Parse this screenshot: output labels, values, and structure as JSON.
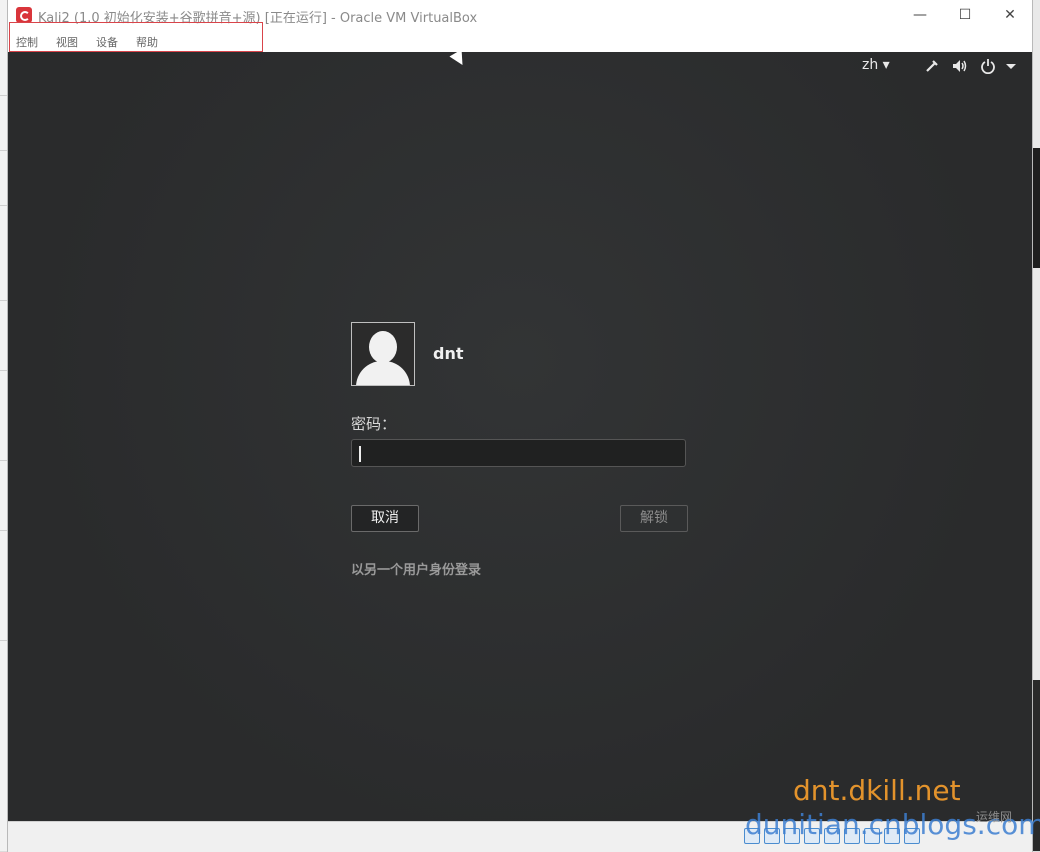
{
  "window": {
    "title": "Kali2 (1.0 初始化安装+谷歌拼音+源) [正在运行] - Oracle VM VirtualBox",
    "controls": {
      "minimize": "—",
      "maximize": "☐",
      "close": "✕"
    }
  },
  "menubar": {
    "items": [
      "控制",
      "视图",
      "设备",
      "帮助"
    ]
  },
  "guest_panel": {
    "language": "zh ▾",
    "icons": [
      "network-icon",
      "volume-icon",
      "power-icon",
      "chevron-down-icon"
    ]
  },
  "login": {
    "username": "dnt",
    "password_label": "密码：",
    "password_value": "",
    "cancel_label": "取消",
    "unlock_label": "解锁",
    "other_user_label": "以另一个用户身份登录"
  },
  "watermark": {
    "main": "dnt.dkill.net",
    "secondary": "dunitian.cnblogs.com",
    "tag": "运维网"
  },
  "colors": {
    "guest_bg": "#2c2e2f",
    "accent_red": "#d9444a",
    "watermark_orange": "#e3932c",
    "watermark_blue": "#3d7fd1"
  }
}
